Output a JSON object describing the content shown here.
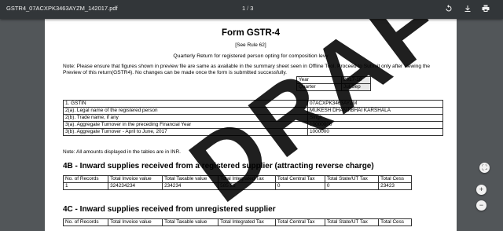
{
  "toolbar": {
    "filename": "GSTR4_07ACXPK3463AYZM_142017.pdf",
    "page_current": "1",
    "page_sep": "/",
    "page_total": "3",
    "icons": [
      "rotate-icon",
      "download-icon",
      "print-icon"
    ]
  },
  "doc": {
    "title": "Form GSTR-4",
    "rule": "[See Rule 62]",
    "subtitle": "Quarterly Return for registered person opting for composition levy",
    "note": "Note: Please ensure that figures shown in preview file are same as available in the summary sheet seen in Offline Tool. Proceed to Submit only after viewing the Preview of this return(GSTR4). No changes can be made once the form is submitted successfully.",
    "year_label": "Year",
    "year_value": "2017-18",
    "quarter_label": "Quarter",
    "quarter_value": "Jul-Sep",
    "gstin_rows": [
      {
        "label": "1. GSTIN",
        "value": "07ACXPK3463AYZM"
      },
      {
        "label": "2(a). Legal name of the registered person",
        "value": "MUKESH DHANJIBHAI KARSHALA"
      },
      {
        "label": "2(b). Trade name, if any",
        "value": "Singh"
      },
      {
        "label": "3(a). Aggregate Turnover in the preceding Financial Year",
        "value": "10000000"
      },
      {
        "label": "3(b). Aggregate Turnover - April to June, 2017",
        "value": "1000000"
      }
    ],
    "amount_note": "Note: All amounts displayed in the tables are in INR.",
    "sec4b_title": "4B - Inward supplies received from a registered supplier (attracting reverse charge)",
    "sec4c_title": "4C - Inward supplies received from unregistered supplier",
    "table_headers": [
      "No. of Records",
      "Total Invoice value",
      "Total Taxable value",
      "Total Integrated Tax",
      "Total Central Tax",
      "Total State/UT Tax",
      "Total Cess"
    ],
    "t4b_row": [
      "1",
      "324234234",
      "234234",
      "585.58",
      "0",
      "0",
      "23423"
    ],
    "watermark": "DRAFT"
  },
  "fab": {
    "fit_label": "⛶",
    "zoom_in_label": "+",
    "zoom_out_label": "−"
  }
}
